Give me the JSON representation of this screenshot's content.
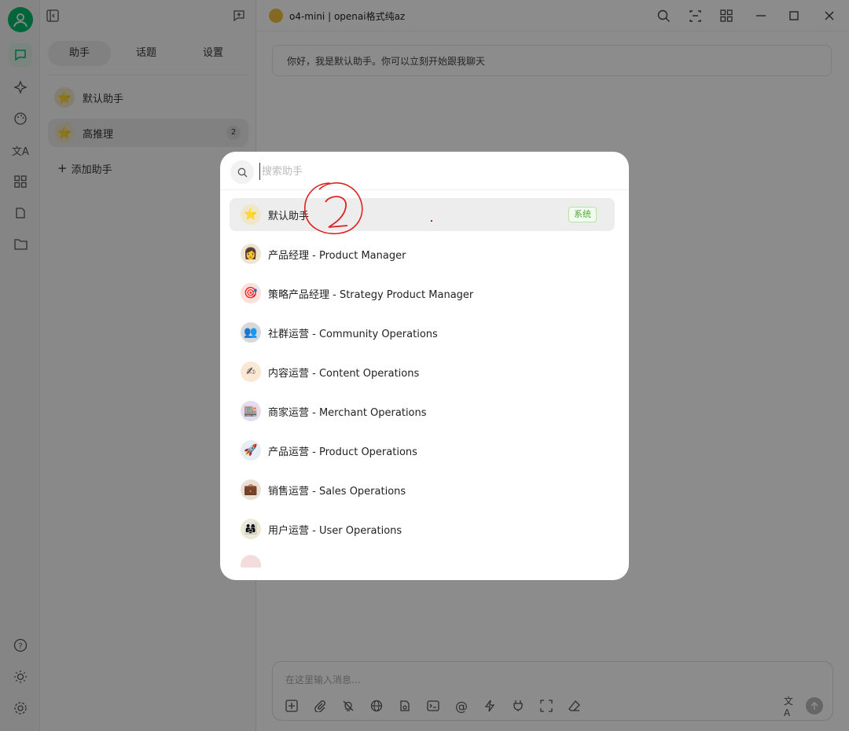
{
  "titlebar": {
    "model": "o4-mini | openai格式纯az"
  },
  "sidebar": {
    "tabs": [
      "助手",
      "话题",
      "设置"
    ],
    "assistants": [
      {
        "name": "默认助手",
        "icon": "star-icon"
      },
      {
        "name": "高推理",
        "icon": "star-icon",
        "count": "2"
      }
    ],
    "add_label": "添加助手"
  },
  "main": {
    "welcome": "你好，我是默认助手。你可以立刻开始跟我聊天",
    "composer_placeholder": "在这里输入消息..."
  },
  "modal": {
    "search_placeholder": "搜索助手",
    "items": [
      {
        "name": "默认助手",
        "icon": "star-icon",
        "badge": "系统"
      },
      {
        "name": "产品经理 - Product Manager",
        "icon": "person-icon"
      },
      {
        "name": "策略产品经理 - Strategy Product Manager",
        "icon": "target-icon"
      },
      {
        "name": "社群运营 - Community Operations",
        "icon": "group-icon"
      },
      {
        "name": "内容运营 - Content Operations",
        "icon": "pencil-icon"
      },
      {
        "name": "商家运营 - Merchant Operations",
        "icon": "store-icon"
      },
      {
        "name": "产品运营 - Product Operations",
        "icon": "rocket-icon"
      },
      {
        "name": "销售运营 - Sales Operations",
        "icon": "briefcase-icon"
      },
      {
        "name": "用户运营 - User Operations",
        "icon": "users-icon"
      }
    ]
  },
  "colors": {
    "accent": "#00b96b",
    "badge_green": "#52a83a"
  }
}
